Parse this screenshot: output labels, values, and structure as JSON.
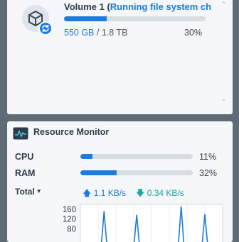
{
  "storage": {
    "volume_name": "Volume 1",
    "open_paren": " (",
    "volume_status": "Running file system ch",
    "used": "550 GB",
    "separator": " / ",
    "total": "1.8 TB",
    "percent_text": "30%",
    "percent_value": 30,
    "icon": "volume-cube-icon",
    "badge_icon": "sync-icon"
  },
  "resource_monitor": {
    "title": "Resource Monitor",
    "cpu_label": "CPU",
    "cpu_percent_text": "11%",
    "cpu_percent": 11,
    "ram_label": "RAM",
    "ram_percent_text": "32%",
    "ram_percent": 32,
    "network_label": "Total",
    "upload": "1.1 KB/s",
    "download": "0.34 KB/s"
  },
  "chart_data": {
    "type": "line",
    "y_ticks": [
      "160",
      "120",
      "80"
    ],
    "values": [
      5,
      5,
      5,
      5,
      5,
      5,
      5,
      5,
      152,
      5,
      5,
      5,
      5,
      5,
      5,
      5,
      5,
      5,
      5,
      137,
      5,
      5,
      5,
      5,
      5,
      5,
      5,
      5,
      5,
      5,
      5,
      5,
      5,
      5,
      172,
      5,
      5,
      5,
      5,
      5,
      5,
      5,
      140,
      5,
      5,
      5,
      5,
      5,
      5
    ],
    "ylim": [
      0,
      180
    ],
    "grid": true
  },
  "colors": {
    "accent": "#1c7be0",
    "download": "#18a5a5",
    "background": "#5f6b77"
  }
}
